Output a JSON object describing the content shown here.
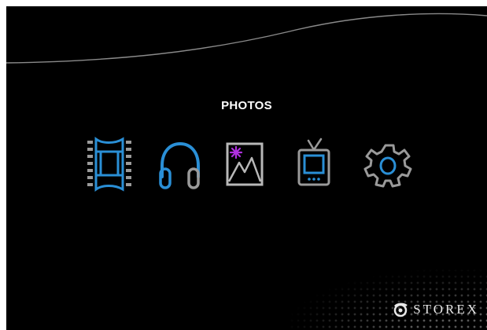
{
  "menu": {
    "selected_label": "PHOTOS",
    "items": [
      {
        "id": "movies",
        "icon": "film-strip-icon",
        "selected": false
      },
      {
        "id": "music",
        "icon": "headphones-icon",
        "selected": false
      },
      {
        "id": "photos",
        "icon": "photo-picture-icon",
        "selected": true
      },
      {
        "id": "tv",
        "icon": "tv-icon",
        "selected": false
      },
      {
        "id": "settings",
        "icon": "gear-icon",
        "selected": false
      }
    ]
  },
  "brand": {
    "name": "STOREX"
  },
  "colors": {
    "background": "#000000",
    "accent_blue": "#2a8fd6",
    "icon_gray": "#b8b8b8",
    "accent_purple": "#b030e0"
  }
}
